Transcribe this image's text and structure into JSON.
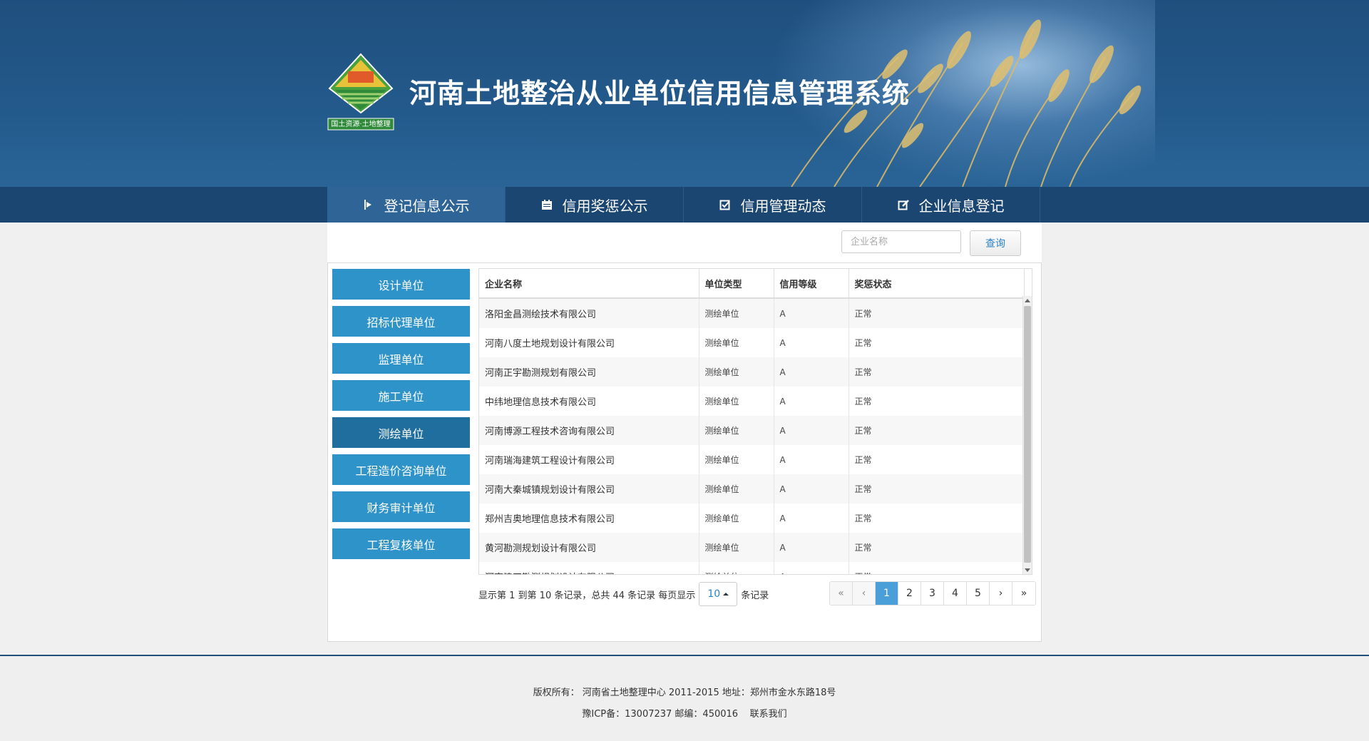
{
  "header": {
    "site_title": "河南土地整治从业单位信用信息管理系统",
    "logo_text": "国土资源·土地整理"
  },
  "nav": [
    {
      "label": "登记信息公示",
      "icon": "signpost-icon",
      "active": true
    },
    {
      "label": "信用奖惩公示",
      "icon": "calendar-icon",
      "active": false
    },
    {
      "label": "信用管理动态",
      "icon": "checkbox-icon",
      "active": false
    },
    {
      "label": "企业信息登记",
      "icon": "edit-icon",
      "active": false
    }
  ],
  "search": {
    "placeholder": "企业名称",
    "button_label": "查询"
  },
  "sidebar": [
    {
      "label": "设计单位",
      "active": false
    },
    {
      "label": "招标代理单位",
      "active": false
    },
    {
      "label": "监理单位",
      "active": false
    },
    {
      "label": "施工单位",
      "active": false
    },
    {
      "label": "测绘单位",
      "active": true
    },
    {
      "label": "工程造价咨询单位",
      "active": false
    },
    {
      "label": "财务审计单位",
      "active": false
    },
    {
      "label": "工程复核单位",
      "active": false
    }
  ],
  "table": {
    "columns": [
      "企业名称",
      "单位类型",
      "信用等级",
      "奖惩状态"
    ],
    "rows": [
      [
        "洛阳金昌测绘技术有限公司",
        "测绘单位",
        "A",
        "正常"
      ],
      [
        "河南八度土地规划设计有限公司",
        "测绘单位",
        "A",
        "正常"
      ],
      [
        "河南正宇勘测规划有限公司",
        "测绘单位",
        "A",
        "正常"
      ],
      [
        "中纬地理信息技术有限公司",
        "测绘单位",
        "A",
        "正常"
      ],
      [
        "河南博源工程技术咨询有限公司",
        "测绘单位",
        "A",
        "正常"
      ],
      [
        "河南瑞海建筑工程设计有限公司",
        "测绘单位",
        "A",
        "正常"
      ],
      [
        "河南大秦城镇规划设计有限公司",
        "测绘单位",
        "A",
        "正常"
      ],
      [
        "郑州吉奥地理信息技术有限公司",
        "测绘单位",
        "A",
        "正常"
      ],
      [
        "黄河勘测规划设计有限公司",
        "测绘单位",
        "A",
        "正常"
      ],
      [
        "河南建正勘测规划设计有限公司",
        "测绘单位",
        "A",
        "正常"
      ]
    ]
  },
  "pager": {
    "info_prefix": "显示第 1 到第 10 条记录，总共 44 条记录 每页显示",
    "page_size": "10",
    "info_suffix": "条记录",
    "buttons": [
      "«",
      "‹",
      "1",
      "2",
      "3",
      "4",
      "5",
      "›",
      "»"
    ],
    "current_page": "1"
  },
  "footer": {
    "line1": "版权所有： 河南省土地整理中心 2011-2015 地址：郑州市金水东路18号",
    "icp": "豫ICP备：13007237 邮编：450016",
    "contact": "联系我们"
  },
  "colors": {
    "header_bg": "#235a8c",
    "nav_bg": "#1b4671",
    "nav_active": "#2f6596",
    "sidebar_item": "#2e93c9",
    "sidebar_active": "#1f6e9e",
    "page_current": "#4a9fd8"
  }
}
